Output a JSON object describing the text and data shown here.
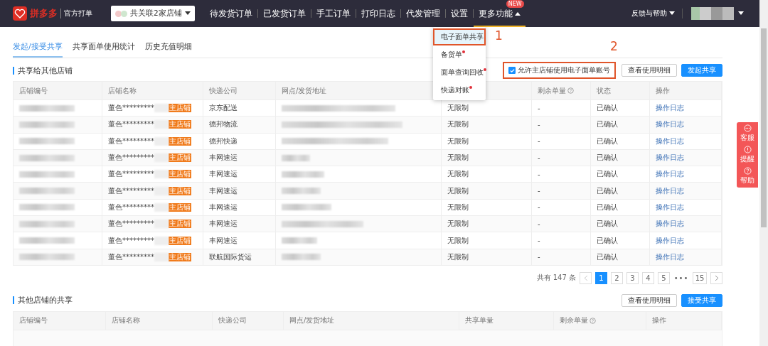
{
  "header": {
    "logo_text": "拼多多",
    "subtitle": "官方打单",
    "store_selector": "共关联2家店铺",
    "nav": [
      {
        "label": "待发货订单",
        "selected": false
      },
      {
        "label": "已发货订单",
        "selected": false
      },
      {
        "label": "手工订单",
        "selected": false
      },
      {
        "label": "打印日志",
        "selected": false
      },
      {
        "label": "代发管理",
        "selected": false
      },
      {
        "label": "设置",
        "selected": false
      },
      {
        "label": "更多功能",
        "selected": true,
        "badge": "NEW"
      }
    ],
    "help": "反馈与帮助"
  },
  "dropdown": [
    {
      "label": "电子面单共享",
      "selected": true,
      "new": false
    },
    {
      "label": "备货单",
      "selected": false,
      "new": true
    },
    {
      "label": "面单查询回收",
      "selected": false,
      "new": true
    },
    {
      "label": "快递对账",
      "selected": false,
      "new": true
    }
  ],
  "tabs": [
    {
      "label": "发起/接受共享",
      "selected": true
    },
    {
      "label": "共享面单使用统计",
      "selected": false
    },
    {
      "label": "历史充值明细",
      "selected": false
    }
  ],
  "share_out": {
    "title": "共享给其他店铺",
    "checkbox": {
      "label": "允许主店铺使用电子面单账号",
      "checked": true
    },
    "buttons": [
      "查看使用明细",
      "发起共享"
    ],
    "columns": [
      "店铺编号",
      "店铺名称",
      "快递公司",
      "网点/发货地址",
      null,
      "剩余单量",
      "状态",
      "操作"
    ],
    "rows": [
      {
        "name": "董色*********",
        "tag": "主店铺",
        "courier": "京东配送",
        "limit": "无限制",
        "remaining": "-",
        "status": "已确认",
        "action": "操作日志"
      },
      {
        "name": "董色*********",
        "tag": "主店铺",
        "courier": "德邦物流",
        "limit": "无限制",
        "remaining": "-",
        "status": "已确认",
        "action": "操作日志"
      },
      {
        "name": "董色*********",
        "tag": "主店铺",
        "courier": "德邦快递",
        "limit": "无限制",
        "remaining": "-",
        "status": "已确认",
        "action": "操作日志"
      },
      {
        "name": "董色*********",
        "tag": "主店铺",
        "courier": "丰网速运",
        "limit": "无限制",
        "remaining": "-",
        "status": "已确认",
        "action": "操作日志"
      },
      {
        "name": "董色*********",
        "tag": "主店铺",
        "courier": "丰网速运",
        "limit": "无限制",
        "remaining": "-",
        "status": "已确认",
        "action": "操作日志"
      },
      {
        "name": "董色*********",
        "tag": "主店铺",
        "courier": "丰网速运",
        "limit": "无限制",
        "remaining": "-",
        "status": "已确认",
        "action": "操作日志"
      },
      {
        "name": "董色*********",
        "tag": "主店铺",
        "courier": "丰网速运",
        "limit": "无限制",
        "remaining": "-",
        "status": "已确认",
        "action": "操作日志"
      },
      {
        "name": "董色*********",
        "tag": "主店铺",
        "courier": "丰网速运",
        "limit": "无限制",
        "remaining": "-",
        "status": "已确认",
        "action": "操作日志"
      },
      {
        "name": "董色*********",
        "tag": "主店铺",
        "courier": "丰网速运",
        "limit": "无限制",
        "remaining": "-",
        "status": "已确认",
        "action": "操作日志"
      },
      {
        "name": "董色*********",
        "tag": "主店铺",
        "courier": "联航国际货运",
        "limit": "无限制",
        "remaining": "-",
        "status": "已确认",
        "action": "操作日志"
      }
    ],
    "pagination": {
      "total": "共有 147 条",
      "pages": [
        {
          "label": "1",
          "selected": true
        },
        {
          "label": "2",
          "selected": false
        },
        {
          "label": "3",
          "selected": false
        },
        {
          "label": "4",
          "selected": false
        },
        {
          "label": "5",
          "selected": false
        },
        {
          "label": "•••",
          "selected": false,
          "kind": "ellipsis"
        },
        {
          "label": "15",
          "selected": false
        }
      ]
    }
  },
  "share_in": {
    "title": "其他店铺的共享",
    "buttons": [
      "查看使用明细",
      "接受共享"
    ],
    "columns": [
      "店铺编号",
      "店铺名称",
      "快递公司",
      "网点/发货地址",
      "共享单量",
      "剩余单量",
      "操作"
    ]
  },
  "side_panel": [
    "客服",
    "提醒",
    "帮助"
  ],
  "annotations": [
    "1",
    "2"
  ]
}
